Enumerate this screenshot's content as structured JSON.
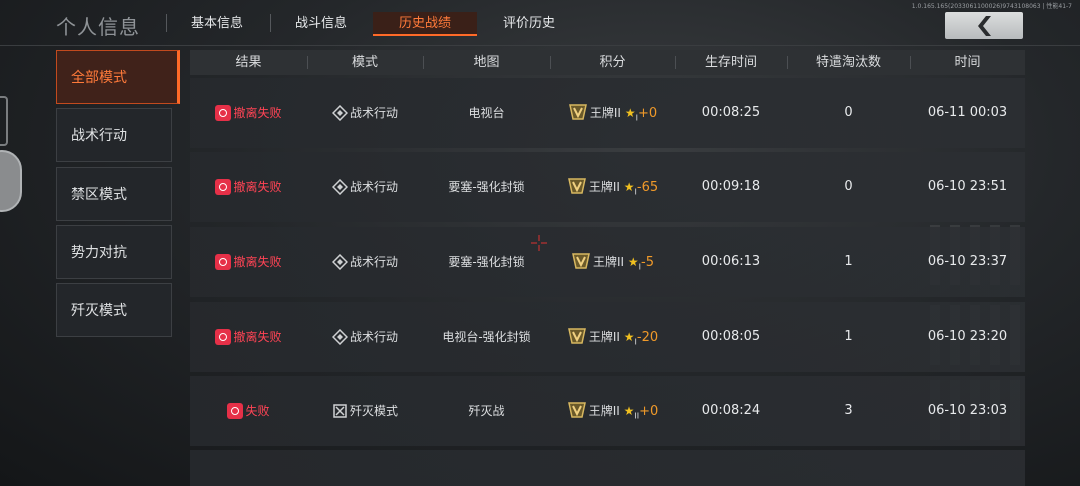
{
  "header": {
    "title": "个人信息",
    "tabs": [
      {
        "label": "基本信息",
        "active": false
      },
      {
        "label": "战斗信息",
        "active": false
      },
      {
        "label": "历史战绩",
        "active": true
      },
      {
        "label": "评价历史",
        "active": false
      }
    ],
    "sysinfo": "1.0.165.165(2033061100026)9743108063 | 性能41-7"
  },
  "sidebar": {
    "items": [
      {
        "label": "全部模式",
        "active": true
      },
      {
        "label": "战术行动",
        "active": false
      },
      {
        "label": "禁区模式",
        "active": false
      },
      {
        "label": "势力对抗",
        "active": false
      },
      {
        "label": "歼灭模式",
        "active": false
      }
    ]
  },
  "table": {
    "columns": [
      "结果",
      "模式",
      "地图",
      "积分",
      "生存时间",
      "特遣淘汰数",
      "时间"
    ],
    "rows": [
      {
        "result": "撤离失败",
        "mode": "战术行动",
        "map": "电视台",
        "rank": "王牌II",
        "star_sub": "I",
        "delta": "+0",
        "survival": "00:08:25",
        "kills": "0",
        "time": "06-11 00:03"
      },
      {
        "result": "撤离失败",
        "mode": "战术行动",
        "map": "要塞-强化封锁",
        "rank": "王牌II",
        "star_sub": "I",
        "delta": "-65",
        "survival": "00:09:18",
        "kills": "0",
        "time": "06-10 23:51"
      },
      {
        "result": "撤离失败",
        "mode": "战术行动",
        "map": "要塞-强化封锁",
        "rank": "王牌II",
        "star_sub": "I",
        "delta": "-5",
        "survival": "00:06:13",
        "kills": "1",
        "time": "06-10 23:37"
      },
      {
        "result": "撤离失败",
        "mode": "战术行动",
        "map": "电视台-强化封锁",
        "rank": "王牌II",
        "star_sub": "I",
        "delta": "-20",
        "survival": "00:08:05",
        "kills": "1",
        "time": "06-10 23:20"
      },
      {
        "result": "失败",
        "mode": "歼灭模式",
        "map": "歼灭战",
        "rank": "王牌II",
        "star_sub": "II",
        "delta": "+0",
        "survival": "00:08:24",
        "kills": "3",
        "time": "06-10 23:03"
      }
    ]
  },
  "colors": {
    "accent": "#ff6a28",
    "fail": "#e63048",
    "delta": "#f09a2a",
    "star": "#f0c020"
  }
}
